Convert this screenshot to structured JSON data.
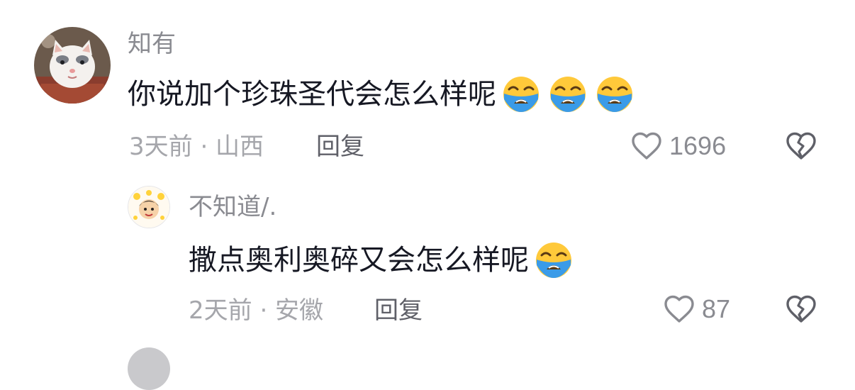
{
  "comments": [
    {
      "author": "知有",
      "text": "你说加个珍珠圣代会怎么样呢",
      "emojis": [
        "loudly-crying-face-emoji",
        "loudly-crying-face-emoji",
        "loudly-crying-face-emoji"
      ],
      "time_location": "3天前 · 山西",
      "reply_label": "回复",
      "likes": "1696"
    },
    {
      "author": "不知道/.",
      "text": "撒点奥利奥碎又会怎么样呢",
      "emojis": [
        "loudly-crying-face-emoji"
      ],
      "time_location": "2天前 · 安徽",
      "reply_label": "回复",
      "likes": "87"
    }
  ],
  "icons": {
    "like": "heart-outline-icon",
    "dislike": "broken-heart-icon"
  },
  "colors": {
    "text_primary": "#161823",
    "text_secondary": "#8a8b91",
    "text_tertiary": "#a5a6ab",
    "emoji_face": "#ffc93a",
    "emoji_tears": "#3a9be8"
  }
}
